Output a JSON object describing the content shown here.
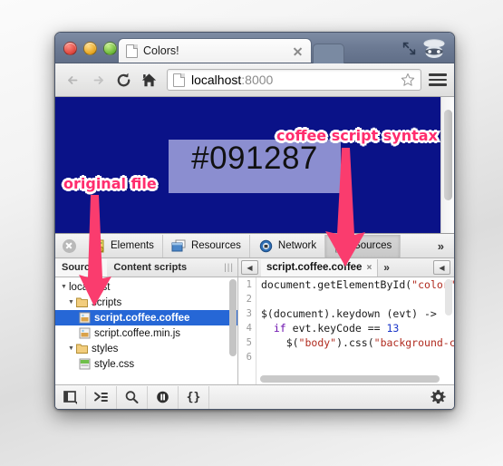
{
  "window": {
    "tab_title": "Colors!",
    "url_host": "localhost",
    "url_port": ":8000",
    "traffic_lights": [
      "close-red",
      "minimize-yellow",
      "zoom-green"
    ],
    "icons": {
      "back": "back-arrow-icon",
      "forward": "forward-arrow-icon",
      "reload": "reload-icon",
      "home": "home-icon",
      "bookmark": "star-icon",
      "menu": "hamburger-menu-icon",
      "incognito": "incognito-icon",
      "fullscreen": "fullscreen-icon",
      "tab_close": "close-icon",
      "tab_favicon": "page-icon"
    }
  },
  "page": {
    "color_value": "#091287",
    "background_color": "#0a1288",
    "selection_color": "rgba(190,190,235,.72)"
  },
  "devtools": {
    "tabs": [
      {
        "label": "Elements",
        "icon": "elements-icon",
        "active": false
      },
      {
        "label": "Resources",
        "icon": "resources-icon",
        "active": false
      },
      {
        "label": "Network",
        "icon": "network-icon",
        "active": false
      },
      {
        "label": "Sources",
        "icon": "sources-icon",
        "active": true
      }
    ],
    "more_label": "»",
    "close_icon": "close-devtools-icon",
    "subtabs": [
      {
        "label": "Sources",
        "active": true
      },
      {
        "label": "Content scripts",
        "active": false
      }
    ],
    "open_file_tab": {
      "label": "script.coffee.coffee",
      "close": "×"
    },
    "file_overflow_label": "»",
    "nav_prev_icon": "collapse-left-icon",
    "dock_right_icon": "collapse-right-icon",
    "tree": [
      {
        "label": "localhost",
        "depth": 0,
        "type": "domain",
        "arrow": "▼",
        "selected": false
      },
      {
        "label": "scripts",
        "depth": 1,
        "type": "folder",
        "arrow": "▼",
        "selected": false
      },
      {
        "label": "script.coffee.coffee",
        "depth": 2,
        "type": "file-script",
        "arrow": "",
        "selected": true
      },
      {
        "label": "script.coffee.min.js",
        "depth": 2,
        "type": "file-script",
        "arrow": "",
        "selected": false
      },
      {
        "label": "styles",
        "depth": 1,
        "type": "folder",
        "arrow": "▼",
        "selected": false
      },
      {
        "label": "style.css",
        "depth": 2,
        "type": "file-css",
        "arrow": "",
        "selected": false
      }
    ],
    "line_numbers": [
      "1",
      "2",
      "3",
      "4",
      "5",
      "6"
    ],
    "code_lines": [
      "document.getElementById(\"color\")",
      "",
      "$(document).keydown (evt) ->",
      "  if evt.keyCode == 13",
      "    $(\"body\").css(\"background-co",
      ""
    ],
    "status_buttons": [
      {
        "icon": "dock-panel-icon",
        "label": ""
      },
      {
        "icon": "console-prompt-icon",
        "label": ""
      },
      {
        "icon": "search-icon",
        "label": ""
      },
      {
        "icon": "pause-on-exception-icon",
        "label": ""
      },
      {
        "icon": "pretty-print-icon",
        "label": "{}"
      }
    ],
    "settings_icon": "gear-icon"
  },
  "annotations": [
    {
      "id": "original-file",
      "text": "original file"
    },
    {
      "id": "coffee-script-syntax",
      "text": "coffee script syntax"
    }
  ]
}
